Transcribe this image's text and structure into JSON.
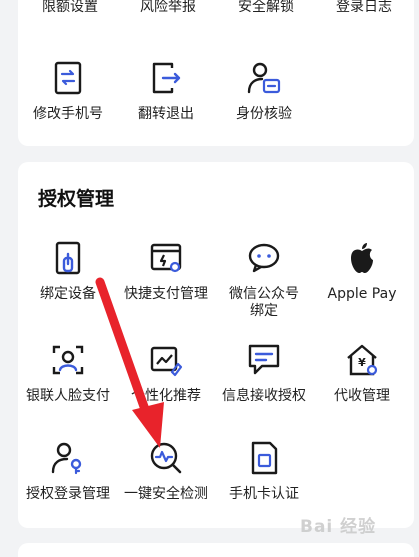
{
  "top_row": [
    "限额设置",
    "风险举报",
    "安全解锁",
    "登录日志"
  ],
  "row2": [
    {
      "label": "修改手机号",
      "icon": "phone-transfer-icon"
    },
    {
      "label": "翻转退出",
      "icon": "logout-icon"
    },
    {
      "label": "身份核验",
      "icon": "id-verify-icon"
    }
  ],
  "auth": {
    "title": "授权管理",
    "items": [
      {
        "label": "绑定设备",
        "icon": "bind-device-icon"
      },
      {
        "label": "快捷支付管理",
        "icon": "quick-pay-icon"
      },
      {
        "label": "微信公众号\n绑定",
        "icon": "wechat-icon"
      },
      {
        "label": "Apple Pay",
        "icon": "apple-icon"
      },
      {
        "label": "银联人脸支付",
        "icon": "face-pay-icon"
      },
      {
        "label": "个性化推荐",
        "icon": "recommend-icon"
      },
      {
        "label": "信息接收授权",
        "icon": "message-auth-icon"
      },
      {
        "label": "代收管理",
        "icon": "collect-icon"
      },
      {
        "label": "授权登录管理",
        "icon": "auth-login-icon"
      },
      {
        "label": "一键安全检测",
        "icon": "security-check-icon"
      },
      {
        "label": "手机卡认证",
        "icon": "sim-card-icon"
      }
    ]
  },
  "watermark": "Bai 经验",
  "colors": {
    "accent": "#3b5bdb",
    "annotation": "#e8232b"
  }
}
